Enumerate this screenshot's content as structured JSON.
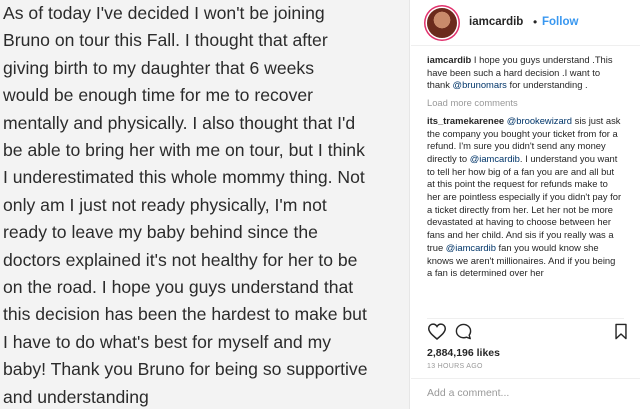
{
  "post": {
    "text": "As of today I've decided I won't be joining\nBruno on tour this Fall. I thought that after\ngiving birth to my daughter that 6 weeks\nwould be enough time for me to recover\nmentally and physically. I also thought that I'd\nbe able to bring her with me on tour, but I think\nI underestimated this whole mommy thing. Not\nonly am I just not ready physically, I'm not\nready to leave my baby behind since the\ndoctors explained it's not healthy for her to be\non the road. I hope you guys understand that\nthis decision has been the hardest to make but\nI have to do what's best for myself and my\nbaby! Thank you Bruno for being so supportive\nand understanding"
  },
  "header": {
    "username": "iamcardib",
    "separator": "•",
    "follow_label": "Follow"
  },
  "caption": {
    "username": "iamcardib",
    "text_before": " I hope you guys understand .This have been such a hard decision .I want to thank ",
    "mention": "@brunomars",
    "text_after": " for understanding ."
  },
  "load_more_label": "Load more comments",
  "comment": {
    "username": "its_tramekarenee",
    "mention1": "@brookewizard",
    "text1": " sis just ask the company you bought your ticket from for a refund. I'm sure you didn't send any money directly to ",
    "mention2": "@iamcardib",
    "text2": ". I understand you want to tell her how big of a fan you are and all but at this point the request for refunds make to her are pointless especially if you didn't pay for a ticket directly from her. Let her not be more devastated at having to choose between her fans and her child. And sis if you really was a true ",
    "mention3": "@iamcardib",
    "text3": " fan you would know she knows we aren't millionaires. And if you being a fan is determined over her"
  },
  "likes": "2,884,196 likes",
  "timestamp": "13 HOURS AGO",
  "add_comment_placeholder": "Add a comment...",
  "colors": {
    "accent": "#3897f0",
    "mention": "#003569",
    "muted": "#999999",
    "text": "#262626"
  },
  "icons": [
    "heart-icon",
    "comment-icon",
    "bookmark-icon",
    "verified-icon"
  ]
}
